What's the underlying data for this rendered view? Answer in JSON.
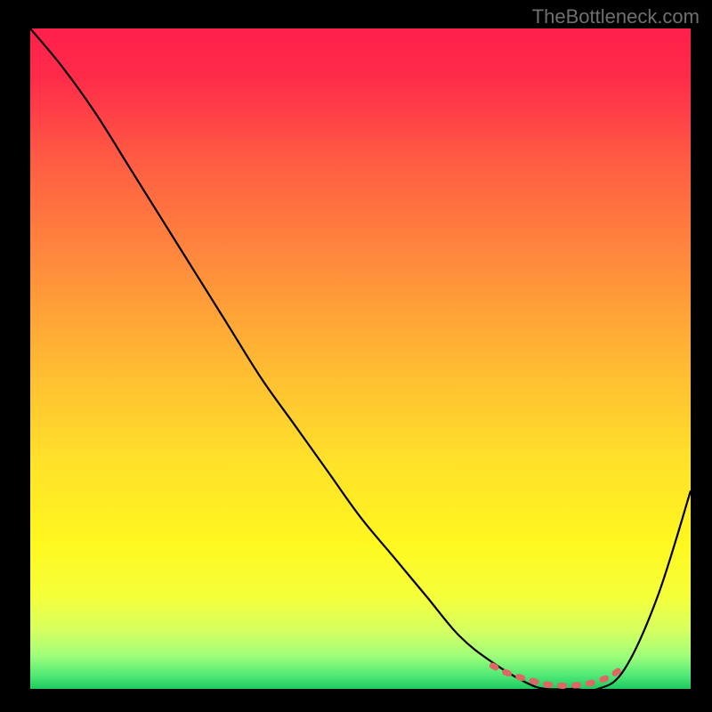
{
  "watermark": "TheBottleneck.com",
  "chart_data": {
    "type": "line",
    "title": "",
    "xlabel": "",
    "ylabel": "",
    "xlim": [
      0,
      100
    ],
    "ylim": [
      0,
      100
    ],
    "series": [
      {
        "name": "bottleneck-curve",
        "x": [
          0,
          5,
          10,
          15,
          20,
          25,
          30,
          35,
          40,
          45,
          50,
          55,
          60,
          65,
          70,
          75,
          78,
          82,
          86,
          90,
          95,
          100
        ],
        "y": [
          100,
          94,
          87,
          79,
          71,
          63,
          55,
          47,
          40,
          33,
          26,
          20,
          14,
          8,
          4,
          1,
          0,
          0,
          0,
          3,
          14,
          30
        ]
      },
      {
        "name": "optimal-zone-marker",
        "x": [
          70,
          72,
          74,
          76,
          78,
          80,
          82,
          84,
          86,
          88,
          90
        ],
        "y": [
          3.5,
          2.5,
          1.8,
          1.2,
          0.7,
          0.5,
          0.5,
          0.7,
          1.2,
          2.0,
          3.5
        ]
      }
    ],
    "gradient_stops": [
      {
        "offset": 0,
        "color": "#ff1f4b"
      },
      {
        "offset": 8,
        "color": "#ff2d49"
      },
      {
        "offset": 20,
        "color": "#ff5c43"
      },
      {
        "offset": 35,
        "color": "#ff8a3d"
      },
      {
        "offset": 50,
        "color": "#ffb733"
      },
      {
        "offset": 65,
        "color": "#ffe02a"
      },
      {
        "offset": 78,
        "color": "#fff71f"
      },
      {
        "offset": 86,
        "color": "#f5ff3a"
      },
      {
        "offset": 91,
        "color": "#d7ff5f"
      },
      {
        "offset": 95,
        "color": "#a0ff7a"
      },
      {
        "offset": 98,
        "color": "#4fe876"
      },
      {
        "offset": 100,
        "color": "#1ecb5f"
      }
    ]
  }
}
